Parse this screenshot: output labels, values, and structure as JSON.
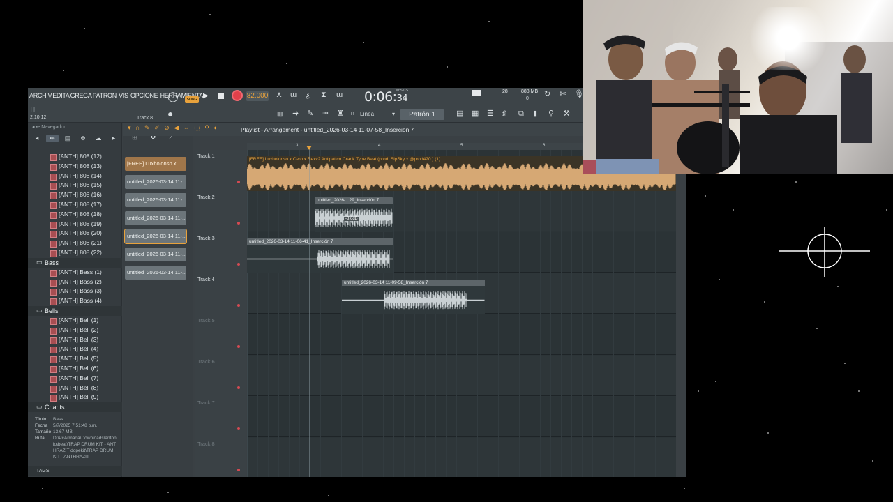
{
  "menu": {
    "items": [
      "ARCHIV",
      "EDITA",
      "GREGA",
      "PATRON",
      "VIS",
      "OPCIONE",
      "HERRAMIENTA"
    ]
  },
  "transport": {
    "song_badge": "SONG",
    "bpm": "82.000",
    "time": "0:06",
    "time_sub": "34",
    "time_units": "M:S:CS",
    "song_position": "2:10:12",
    "track_label": "Track 8",
    "cpu": "28",
    "memory": "888 MB",
    "memory_sub": "0",
    "snap": "Línea",
    "pattern": "Patrón 1"
  },
  "browser": {
    "header": "Navegador",
    "items_808": [
      "[ANTH] 808 (12)",
      "[ANTH] 808 (13)",
      "[ANTH] 808 (14)",
      "[ANTH] 808 (15)",
      "[ANTH] 808 (16)",
      "[ANTH] 808 (17)",
      "[ANTH] 808 (18)",
      "[ANTH] 808 (19)",
      "[ANTH] 808 (20)",
      "[ANTH] 808 (21)",
      "[ANTH] 808 (22)"
    ],
    "folder_bass": "Bass",
    "items_bass": [
      "[ANTH] Bass (1)",
      "[ANTH] Bass (2)",
      "[ANTH] Bass (3)",
      "[ANTH] Bass (4)"
    ],
    "folder_bells": "Bells",
    "items_bells": [
      "[ANTH] Bell (1)",
      "[ANTH] Bell (2)",
      "[ANTH] Bell (3)",
      "[ANTH] Bell (4)",
      "[ANTH] Bell (5)",
      "[ANTH] Bell (6)",
      "[ANTH] Bell (7)",
      "[ANTH] Bell (8)",
      "[ANTH] Bell (9)"
    ],
    "folder_chants": "Chants",
    "info": {
      "titulo_k": "Título",
      "titulo_v": "Bass",
      "fecha_k": "Fecha",
      "fecha_v": "5/7/2025 7:51:48 p.m.",
      "tamano_k": "Tamaño",
      "tamano_v": "13.67 MB",
      "ruta_k": "Ruta",
      "ruta_v": "D:\\PcArmada\\Downloads\\antonio\\beat\\TRAP DRUM KIT - ANTHRAZIT dopekit\\TRAP DRUM KIT - ANTHRAZIT"
    },
    "tags": "TAGS"
  },
  "patterns": [
    "[FREE] Luxholonso x...",
    "untitled_2026-03-14 11-...",
    "untitled_2026-03-14 11-...",
    "untitled_2026-03-14 11-...",
    "untitled_2026-03-14 11-...",
    "untitled_2026-03-14 11-...",
    "untitled_2026-03-14 11-..."
  ],
  "playlist": {
    "title": "Playlist - Arrangement",
    "project": "untitled_2026-03-14 11-07-58_Inserción 7",
    "ruler": [
      "3",
      "4",
      "5",
      "6"
    ],
    "tracks": [
      "Track 1",
      "Track 2",
      "Track 3",
      "Track 4",
      "Track 5",
      "Track 6",
      "Track 7",
      "Track 8"
    ],
    "clips": {
      "c1": "[FREE] Luxholonso x Cero x Rexv2 Antipático  Crank Type Beat  (prod. SipSky x @prod420 ) (1)",
      "c2": "untitled_2026-...29_Inserción 7",
      "c2_gain": "-8.6dB",
      "c3": "untitled_2026-03-14 11-06-41_Inserción 7",
      "c4": "untitled_2026-03-14 11-09-58_Inserción 7"
    }
  }
}
